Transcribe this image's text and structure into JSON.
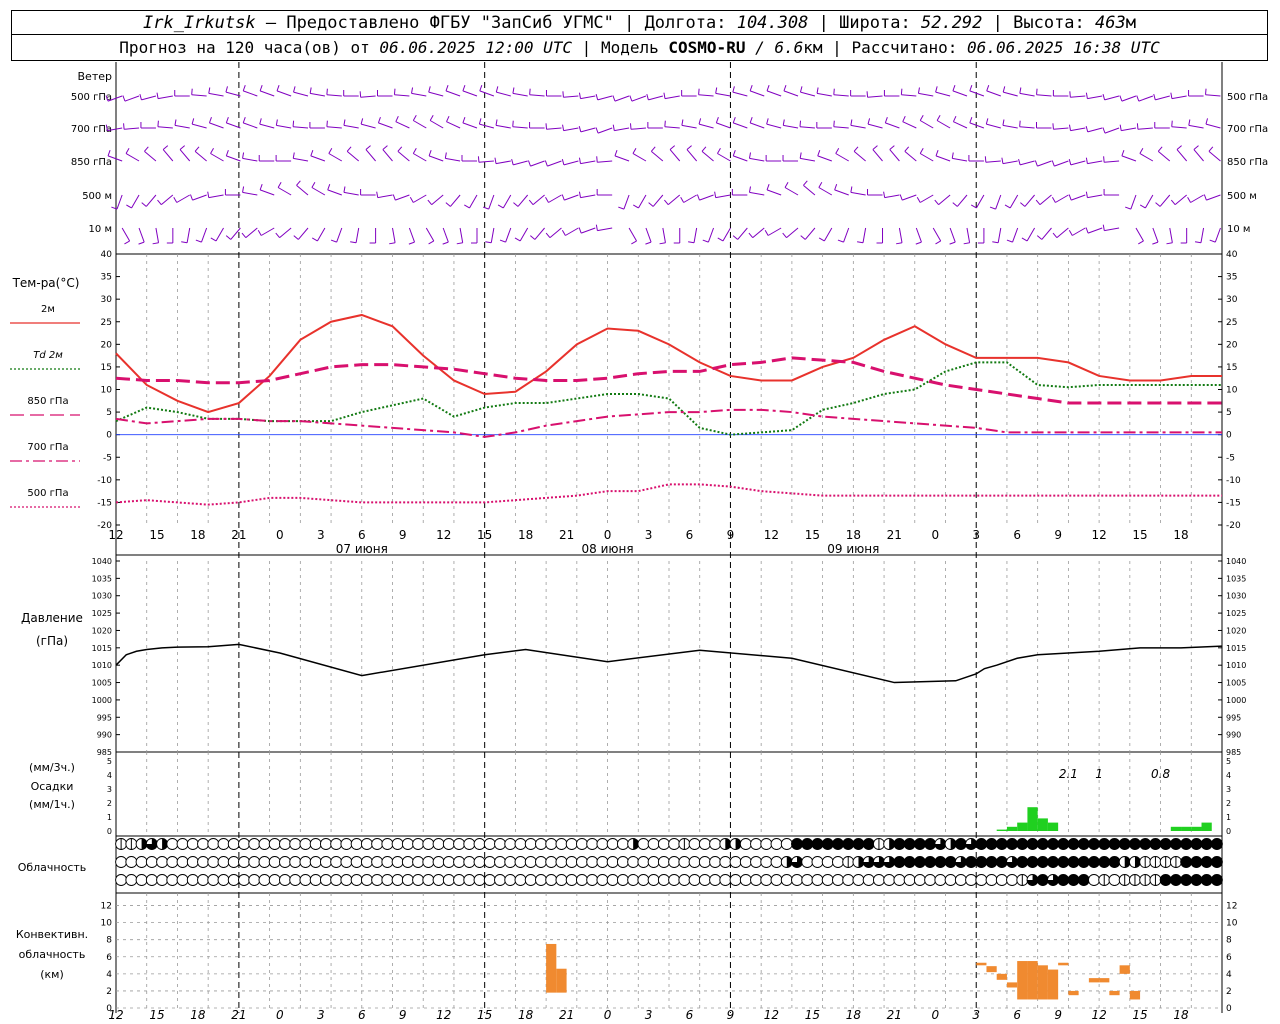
{
  "header": {
    "station": "Irk_Irkutsk",
    "dash": "—",
    "provider": "Предоставлено ФГБУ \"ЗапСиб УГМС\"",
    "lon_label": "Долгота:",
    "lon": "104.308",
    "lat_label": "Широта:",
    "lat": "52.292",
    "alt_label": "Высота:",
    "alt": "463",
    "alt_unit": "м",
    "forecast_prefix": "Прогноз на 120 часа(ов) от",
    "forecast_date": "06.06.2025 12:00 UTC",
    "model_label": "Модель",
    "model": "COSMO-RU",
    "resolution": "/ 6.6",
    "res_unit": "км",
    "computed_label": "Рассчитано:",
    "computed": "06.06.2025 16:38 UTC"
  },
  "wind_panel": {
    "title": "Ветер",
    "levels": [
      "500 гПа",
      "700 гПа",
      "850 гПа",
      "500 м",
      "10 м"
    ],
    "color": "#8000c0"
  },
  "temp_panel": {
    "title": "Тем-ра(°C)",
    "legend": [
      {
        "label": "2м",
        "color": "#e8322c"
      },
      {
        "label": "Td 2м",
        "color": "#127a12"
      },
      {
        "label": "850 гПа",
        "color": "#d8106e"
      },
      {
        "label": "700 гПа",
        "color": "#d8106e"
      },
      {
        "label": "500 гПа",
        "color": "#d8106e"
      }
    ],
    "yticks": [
      "40",
      "35",
      "30",
      "25",
      "20",
      "15",
      "10",
      "5",
      "0",
      "-5",
      "-10",
      "-15",
      "-20"
    ]
  },
  "pressure_panel": {
    "title": "Давление",
    "unit": "(гПа)",
    "yticks": [
      "1040",
      "1035",
      "1030",
      "1025",
      "1020",
      "1015",
      "1010",
      "1005",
      "1000",
      "995",
      "990",
      "985"
    ]
  },
  "precip_panel": {
    "unit1": "(мм/3ч.)",
    "title": "Осадки",
    "unit2": "(мм/1ч.)",
    "yticks": [
      "5",
      "4",
      "3",
      "2",
      "1",
      "0"
    ],
    "sums": [
      {
        "label": "2.1",
        "hour": 93
      },
      {
        "label": "1",
        "hour": 96
      },
      {
        "label": "0.8",
        "hour": 102
      }
    ]
  },
  "cloud_panel": {
    "title": "Облачность"
  },
  "conv_panel": {
    "title1": "Конвективн.",
    "title2": "облачность",
    "unit": "(км)",
    "yticks": [
      "12",
      "10",
      "8",
      "6",
      "4",
      "2",
      "0"
    ]
  },
  "time_axis": {
    "hour_labels": [
      "12",
      "15",
      "18",
      "21",
      "0",
      "3",
      "6",
      "9",
      "12",
      "15",
      "18",
      "21",
      "0",
      "3",
      "6",
      "9",
      "12",
      "15",
      "18",
      "21",
      "0",
      "3",
      "6",
      "9",
      "12",
      "15",
      "18"
    ],
    "day_labels": [
      {
        "label": "07 июня",
        "hour": 24
      },
      {
        "label": "08 июня",
        "hour": 48
      },
      {
        "label": "09 июня",
        "hour": 72
      }
    ]
  },
  "chart_data": [
    {
      "type": "line",
      "title": "Тем-ра(°C)",
      "x_unit": "hours since 06.06.2025 12:00 UTC",
      "ylim": [
        -20,
        40
      ],
      "series": [
        {
          "name": "2м",
          "color": "#e8322c",
          "style": "solid",
          "x": [
            0,
            3,
            6,
            9,
            12,
            15,
            18,
            21,
            24,
            27,
            30,
            33,
            36,
            39,
            42,
            45,
            48,
            51,
            54,
            57,
            60,
            63,
            66,
            69,
            72,
            75,
            78,
            81,
            84,
            87,
            90,
            93,
            96,
            99,
            102,
            105,
            108
          ],
          "y": [
            18,
            11,
            7.5,
            5,
            7,
            13,
            21,
            25,
            26.5,
            24,
            17.5,
            12,
            9,
            9.5,
            14,
            20,
            23.5,
            23,
            20,
            16,
            13,
            12,
            12,
            15,
            17,
            21,
            24,
            20,
            17,
            17,
            17,
            16,
            13,
            12,
            12,
            13,
            13
          ]
        },
        {
          "name": "Td 2м",
          "color": "#127a12",
          "style": "dotted",
          "x": [
            0,
            3,
            6,
            9,
            12,
            15,
            18,
            21,
            24,
            27,
            30,
            33,
            36,
            39,
            42,
            45,
            48,
            51,
            54,
            57,
            60,
            63,
            66,
            69,
            72,
            75,
            78,
            81,
            84,
            87,
            90,
            93,
            96,
            99,
            102,
            105,
            108
          ],
          "y": [
            3,
            6,
            5,
            3.5,
            3.5,
            3,
            3,
            3,
            5,
            6.5,
            8,
            4,
            6,
            7,
            7,
            8,
            9,
            9,
            8,
            1.5,
            0,
            0.5,
            1,
            5.5,
            7,
            9,
            10,
            14,
            16,
            16,
            11,
            10.5,
            11,
            11,
            11,
            11,
            11
          ]
        },
        {
          "name": "850 гПа",
          "color": "#d8106e",
          "style": "dashed",
          "x": [
            0,
            3,
            6,
            9,
            12,
            15,
            18,
            21,
            24,
            27,
            30,
            33,
            36,
            39,
            42,
            45,
            48,
            51,
            54,
            57,
            60,
            63,
            66,
            69,
            72,
            75,
            78,
            81,
            84,
            87,
            90,
            93,
            96,
            99,
            102,
            105,
            108
          ],
          "y": [
            12.5,
            12,
            12,
            11.5,
            11.5,
            12,
            13.5,
            15,
            15.5,
            15.5,
            15,
            14.5,
            13.5,
            12.5,
            12,
            12,
            12.5,
            13.5,
            14,
            14,
            15.5,
            16,
            17,
            16.5,
            16,
            14,
            12.5,
            11,
            10,
            9,
            8,
            7,
            7,
            7,
            7,
            7,
            7
          ]
        },
        {
          "name": "700 гПа",
          "color": "#d8106e",
          "style": "dashdot",
          "x": [
            0,
            3,
            6,
            9,
            12,
            15,
            18,
            21,
            24,
            27,
            30,
            33,
            36,
            39,
            42,
            45,
            48,
            51,
            54,
            57,
            60,
            63,
            66,
            69,
            72,
            75,
            78,
            81,
            84,
            87,
            90,
            93,
            96,
            99,
            102,
            105,
            108
          ],
          "y": [
            3.5,
            2.5,
            3,
            3.5,
            3.5,
            3,
            3,
            2.5,
            2,
            1.5,
            1,
            0.5,
            -0.5,
            0.5,
            2,
            3,
            4,
            4.5,
            5,
            5,
            5.5,
            5.5,
            5,
            4,
            3.5,
            3,
            2.5,
            2,
            1.5,
            0.5,
            0.5,
            0.5,
            0.5,
            0.5,
            0.5,
            0.5,
            0.5
          ]
        },
        {
          "name": "500 гПа",
          "color": "#d8106e",
          "style": "dotted",
          "x": [
            0,
            3,
            6,
            9,
            12,
            15,
            18,
            21,
            24,
            27,
            30,
            33,
            36,
            39,
            42,
            45,
            48,
            51,
            54,
            57,
            60,
            63,
            66,
            69,
            72,
            75,
            78,
            81,
            84,
            87,
            90,
            93,
            96,
            99,
            102,
            105,
            108
          ],
          "y": [
            -15,
            -14.5,
            -15,
            -15.5,
            -15,
            -14,
            -14,
            -14.5,
            -15,
            -15,
            -15,
            -15,
            -15,
            -14.5,
            -14,
            -13.5,
            -12.5,
            -12.5,
            -11,
            -11,
            -11.5,
            -12.5,
            -13,
            -13.5,
            -13.5,
            -13.5,
            -13.5,
            -13.5,
            -13.5,
            -13.5,
            -13.5,
            -13.5,
            -13.5,
            -13.5,
            -13.5,
            -13.5,
            -13.5
          ]
        }
      ]
    },
    {
      "type": "line",
      "title": "Давление",
      "ylabel": "(гПа)",
      "ylim": [
        985,
        1040
      ],
      "series": [
        {
          "name": "Давление",
          "color": "#000000",
          "x": [
            0,
            1,
            2,
            3,
            4.5,
            6,
            9,
            12,
            16,
            24,
            36,
            40,
            48,
            57,
            66,
            76,
            82,
            84,
            84.8,
            86,
            88,
            90,
            96,
            100,
            104,
            108
          ],
          "y": [
            1010,
            1013,
            1014,
            1014.5,
            1015,
            1015.2,
            1015.3,
            1016,
            1013.5,
            1007,
            1013,
            1014.5,
            1011,
            1014.3,
            1012,
            1005,
            1005.5,
            1007.5,
            1009,
            1010,
            1012,
            1013,
            1014,
            1015,
            1015,
            1015.5
          ]
        }
      ]
    },
    {
      "type": "bar",
      "title": "Осадки",
      "ylabel": "(мм/1ч.)",
      "ylim": [
        0,
        5
      ],
      "x": [
        87,
        88,
        89,
        90,
        91,
        92,
        93,
        104,
        105,
        106,
        107,
        108
      ],
      "values": [
        0.1,
        0.3,
        0.6,
        1.7,
        0.9,
        0.6,
        0,
        0.3,
        0.3,
        0.3,
        0.6,
        0
      ],
      "color": "#20d020"
    },
    {
      "type": "bar",
      "title": "Конвективн. облачность",
      "ylabel": "(км)",
      "ylim": [
        0,
        13
      ],
      "bars": [
        {
          "x": 42,
          "bottom": 1.8,
          "top": 7.5
        },
        {
          "x": 43,
          "bottom": 1.8,
          "top": 4.6
        },
        {
          "x": 84,
          "bottom": 5.0,
          "top": 5.3
        },
        {
          "x": 85,
          "bottom": 4.2,
          "top": 4.9
        },
        {
          "x": 86,
          "bottom": 3.3,
          "top": 4.0
        },
        {
          "x": 87,
          "bottom": 2.4,
          "top": 3.0
        },
        {
          "x": 88,
          "bottom": 1.0,
          "top": 5.5
        },
        {
          "x": 89,
          "bottom": 1.0,
          "top": 5.5
        },
        {
          "x": 90,
          "bottom": 1.0,
          "top": 5.0
        },
        {
          "x": 91,
          "bottom": 1.0,
          "top": 4.5
        },
        {
          "x": 92,
          "bottom": 5.0,
          "top": 5.3
        },
        {
          "x": 93,
          "bottom": 1.5,
          "top": 2.0
        },
        {
          "x": 95,
          "bottom": 3.0,
          "top": 3.5
        },
        {
          "x": 96,
          "bottom": 3.0,
          "top": 3.5
        },
        {
          "x": 97,
          "bottom": 1.5,
          "top": 2.0
        },
        {
          "x": 98,
          "bottom": 4.0,
          "top": 5.0
        },
        {
          "x": 99,
          "bottom": 1.0,
          "top": 2.0
        }
      ],
      "color": "#f08a30"
    }
  ]
}
